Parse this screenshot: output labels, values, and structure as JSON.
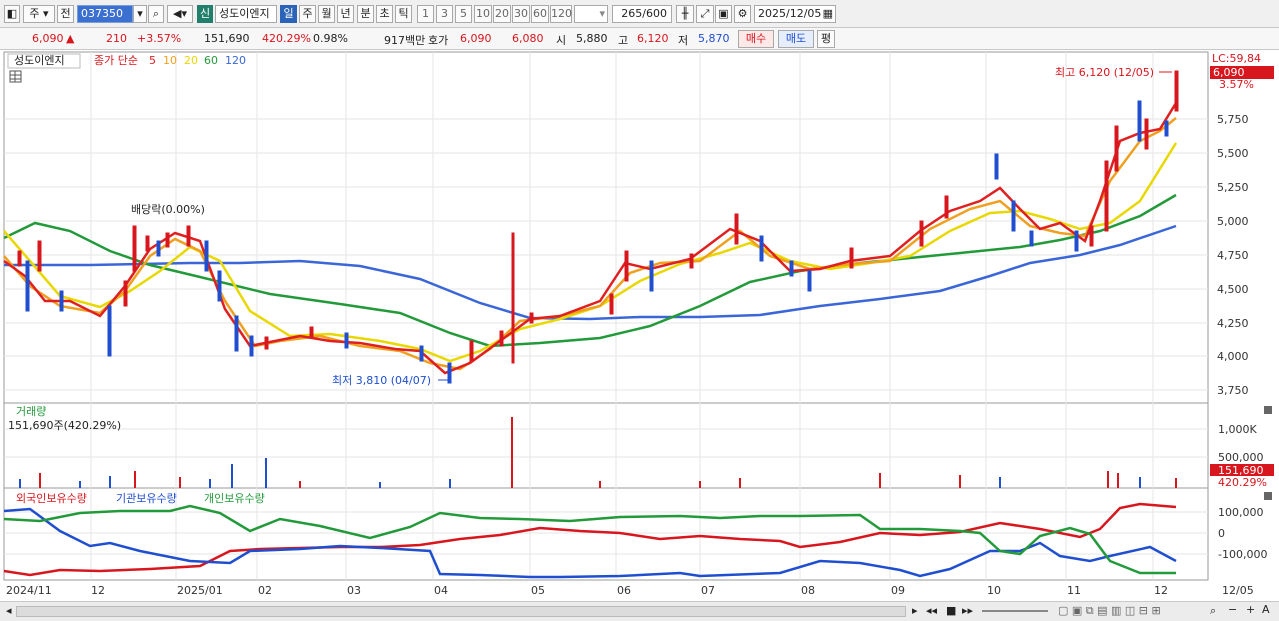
{
  "toolbar": {
    "market_type": "주",
    "period_btn": "전",
    "code": "037350",
    "new_badge": "신",
    "stock_name": "성도이엔지",
    "periods": [
      "일",
      "주",
      "월",
      "년",
      "분",
      "초",
      "틱"
    ],
    "active_period": "일",
    "intervals": [
      "1",
      "3",
      "5",
      "10",
      "20",
      "30",
      "60",
      "120"
    ],
    "count": "265",
    "count_total": "/600",
    "date": "2025/12/05"
  },
  "quote": {
    "price": "6,090",
    "arrow": "▲",
    "change": "210",
    "change_pct": "+3.57%",
    "volume": "151,690",
    "volume_ratio": "420.29%",
    "turnover": "0.98%",
    "amount": "917백만",
    "bid_label": "호가",
    "ask": "6,090",
    "bid": "6,080",
    "open_label": "시",
    "open": "5,880",
    "high_label": "고",
    "high": "6,120",
    "low_label": "저",
    "low": "5,870",
    "buy_btn": "매수",
    "sell_btn": "매도",
    "eval_btn": "평"
  },
  "price_panel": {
    "legend_name": "성도이엔지",
    "legend_ma_label": "종가 단순",
    "ma_periods": [
      {
        "label": "5",
        "color": "#e02020"
      },
      {
        "label": "10",
        "color": "#f0a020"
      },
      {
        "label": "20",
        "color": "#e8d800"
      },
      {
        "label": "60",
        "color": "#239a3a"
      },
      {
        "label": "120",
        "color": "#3a66d8"
      }
    ],
    "lc_label": "LC:59,84",
    "current_price_tag": "6,090",
    "change_tag": "3.57%",
    "high_annotation": "최고 6,120 (12/05)",
    "low_annotation": "최저 3,810 (04/07)",
    "dividend_annotation": "배당락(0.00%)",
    "y_ticks": [
      "5,750",
      "5,500",
      "5,250",
      "5,000",
      "4,750",
      "4,500",
      "4,250",
      "4,000",
      "3,750"
    ]
  },
  "volume_panel": {
    "title": "거래량",
    "value": "151,690주(420.29%)",
    "y_ticks": [
      "1,000K",
      "500,000"
    ],
    "current_tag": "151,690",
    "ratio_tag": "420.29%"
  },
  "holding_panel": {
    "legend": [
      {
        "label": "외국인보유수량",
        "color": "#d8161d"
      },
      {
        "label": "기관보유수량",
        "color": "#1f4fd0"
      },
      {
        "label": "개인보유수량",
        "color": "#239a3a"
      }
    ],
    "y_ticks": [
      "100,000",
      "0",
      "-100,000"
    ]
  },
  "x_axis": [
    "2024/11",
    "12",
    "2025/01",
    "02",
    "03",
    "04",
    "05",
    "06",
    "07",
    "08",
    "09",
    "10",
    "11",
    "12"
  ],
  "x_axis_right": "12/05",
  "chart_data": {
    "type": "candlestick",
    "x_range": [
      "2024/11",
      "2025/12/05"
    ],
    "y_range": [
      3700,
      6150
    ],
    "current": 6090,
    "high": {
      "value": 6120,
      "date": "12/05"
    },
    "low": {
      "value": 3810,
      "date": "04/07"
    },
    "close_approx": [
      4680,
      4550,
      4350,
      4450,
      4400,
      4500,
      4300,
      4250,
      4450,
      4950,
      4800,
      4850,
      4900,
      4700,
      4550,
      4100,
      4050,
      4150,
      4200,
      4100,
      4050,
      4100,
      3900,
      3830,
      4050,
      4250,
      4300,
      4300,
      4600,
      4750,
      4700,
      4700,
      4800,
      4950,
      4700,
      4650,
      4600,
      4650,
      4700,
      4750,
      4800,
      4900,
      5100,
      5000,
      5150,
      4900,
      5000,
      4750,
      4900,
      5500,
      5650,
      5700,
      6090
    ]
  }
}
